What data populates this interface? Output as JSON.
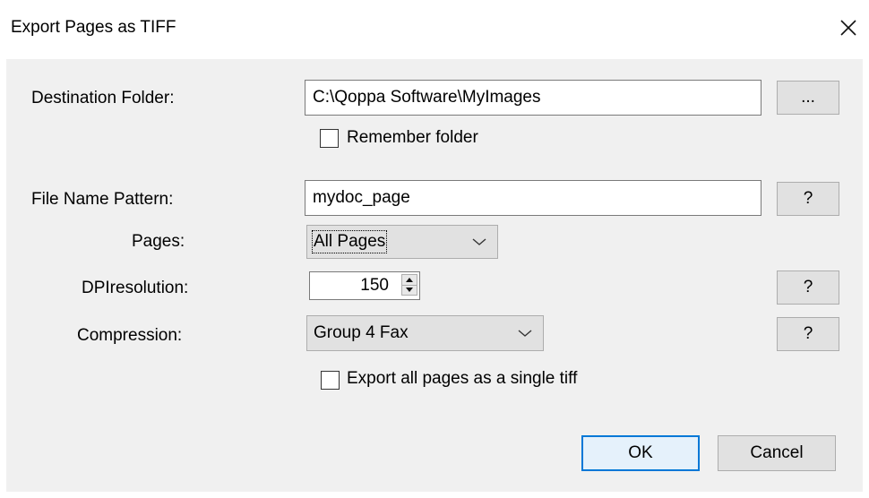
{
  "window": {
    "title": "Export Pages as TIFF"
  },
  "destination": {
    "label": "Destination Folder:",
    "value": "C:\\Qoppa Software\\MyImages",
    "browse_label": "...",
    "remember_label": "Remember folder",
    "remember_checked": false
  },
  "file_name": {
    "label": "File Name Pattern:",
    "value": "mydoc_page",
    "help_label": "?"
  },
  "pages": {
    "label": "Pages:",
    "selected": "All Pages"
  },
  "dpi": {
    "label": "DPIresolution:",
    "value": "150",
    "help_label": "?"
  },
  "compression": {
    "label": "Compression:",
    "selected": "Group 4 Fax",
    "help_label": "?"
  },
  "single_tiff": {
    "label": "Export all pages as a single tiff",
    "checked": false
  },
  "buttons": {
    "ok": "OK",
    "cancel": "Cancel"
  },
  "colors": {
    "accent": "#0078d7",
    "panel": "#f0f0f0"
  }
}
